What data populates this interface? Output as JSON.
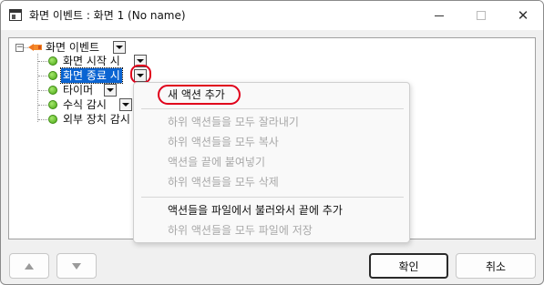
{
  "window": {
    "title": "화면 이벤트 : 화면 1 (No name)"
  },
  "tree": {
    "root_label": "화면 이벤트",
    "root_expander": "−",
    "items": [
      {
        "label": "화면 시작 시",
        "selected": false
      },
      {
        "label": "화면 종료 시",
        "selected": true
      },
      {
        "label": "타이머",
        "selected": false
      },
      {
        "label": "수식 감시",
        "selected": false
      },
      {
        "label": "외부 장치 감시",
        "selected": false
      }
    ]
  },
  "context_menu": {
    "items": [
      {
        "label": "새 액션 추가",
        "enabled": true,
        "highlighted": true
      },
      {
        "label": "하위 액션들을 모두 잘라내기",
        "enabled": false
      },
      {
        "label": "하위 액션들을 모두 복사",
        "enabled": false
      },
      {
        "label": "액션을 끝에 붙여넣기",
        "enabled": false
      },
      {
        "label": "하위 액션들을 모두 삭제",
        "enabled": false
      },
      {
        "label": "액션들을 파일에서 불러와서 끝에 추가",
        "enabled": true
      },
      {
        "label": "하위 액션들을 모두 파일에 저장",
        "enabled": false
      }
    ]
  },
  "footer": {
    "ok_label": "확인",
    "cancel_label": "취소"
  },
  "colors": {
    "selection": "#0a64d2",
    "highlight_circle": "#e0001b",
    "status_dot": "#4aa814",
    "root_icon": "#f07820"
  },
  "icons": {
    "app": "window-icon",
    "root": "event-flag-icon",
    "item": "green-dot-icon",
    "move_up": "arrow-up-icon",
    "move_down": "arrow-down-icon"
  }
}
